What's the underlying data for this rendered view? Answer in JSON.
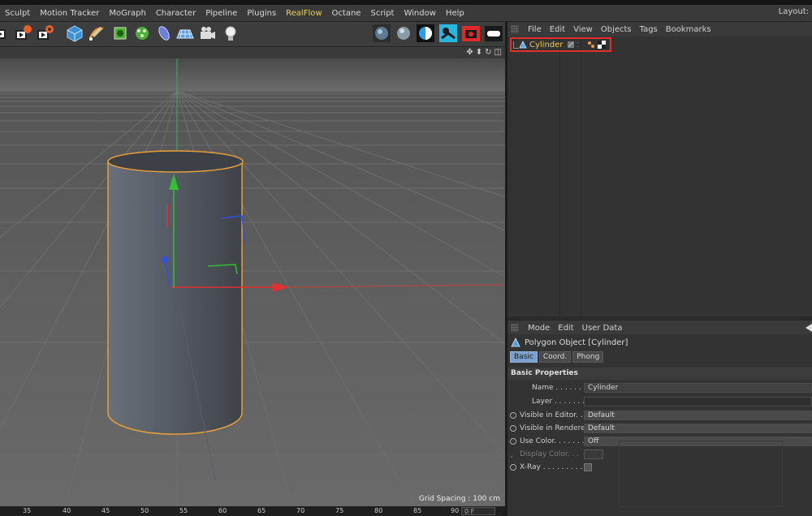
{
  "menubar": {
    "items": [
      {
        "label": "Sculpt"
      },
      {
        "label": "Motion Tracker"
      },
      {
        "label": "MoGraph"
      },
      {
        "label": "Character"
      },
      {
        "label": "Pipeline"
      },
      {
        "label": "Plugins"
      },
      {
        "label": "RealFlow",
        "highlight": true
      },
      {
        "label": "Octane"
      },
      {
        "label": "Script"
      },
      {
        "label": "Window"
      },
      {
        "label": "Help"
      }
    ],
    "layout_label": "Layout:"
  },
  "toolbar": {
    "icons": [
      "render-region-icon",
      "render-view-icon",
      "render-settings-icon",
      "cube-icon",
      "pen-icon",
      "subdivision-icon",
      "mograph-cloner-icon",
      "deformer-icon",
      "floor-icon",
      "camera-icon",
      "light-icon",
      "octane-material-icon",
      "sphere-icon",
      "contrast-icon",
      "realflow-icon",
      "render-camera-icon",
      "rectangle-light-icon"
    ]
  },
  "viewport": {
    "nav_icons": [
      "move-view-icon",
      "zoom-view-icon",
      "rotate-view-icon",
      "maximize-view-icon"
    ],
    "grid_spacing": "Grid Spacing : 100 cm"
  },
  "timeline": {
    "ticks": [
      "35",
      "40",
      "45",
      "50",
      "55",
      "60",
      "65",
      "70",
      "75",
      "80",
      "85",
      "90"
    ],
    "frame_value": "0 F"
  },
  "object_manager": {
    "menu": [
      "File",
      "Edit",
      "View",
      "Objects",
      "Tags",
      "Bookmarks"
    ],
    "object_name": "Cylinder"
  },
  "attribute_manager": {
    "menu": [
      "Mode",
      "Edit",
      "User Data"
    ],
    "title": "Polygon Object [Cylinder]",
    "tabs": [
      {
        "label": "Basic",
        "active": true
      },
      {
        "label": "Coord."
      },
      {
        "label": "Phong"
      }
    ],
    "section": "Basic Properties",
    "props": {
      "name_label": "Name . . . . . . . . . . .",
      "name_value": "Cylinder",
      "layer_label": "Layer . . . . . . . . . . .",
      "vis_editor_label": "Visible in Editor. . .",
      "vis_editor_value": "Default",
      "vis_renderer_label": "Visible in Renderer",
      "vis_renderer_value": "Default",
      "use_color_label": "Use Color. . . . . . . .",
      "use_color_value": "Off",
      "display_color_label": "Display Color. . .",
      "xray_label": "X-Ray . . . . . . . . . . ."
    }
  },
  "colors": {
    "accent_realflow": "#f2d24a",
    "selection_outline": "#e0302a",
    "object_name": "#f2c94c",
    "tab_active": "#7aa0cc",
    "axis_x": "#e03030",
    "axis_y": "#30c030",
    "axis_z": "#3050e0"
  }
}
